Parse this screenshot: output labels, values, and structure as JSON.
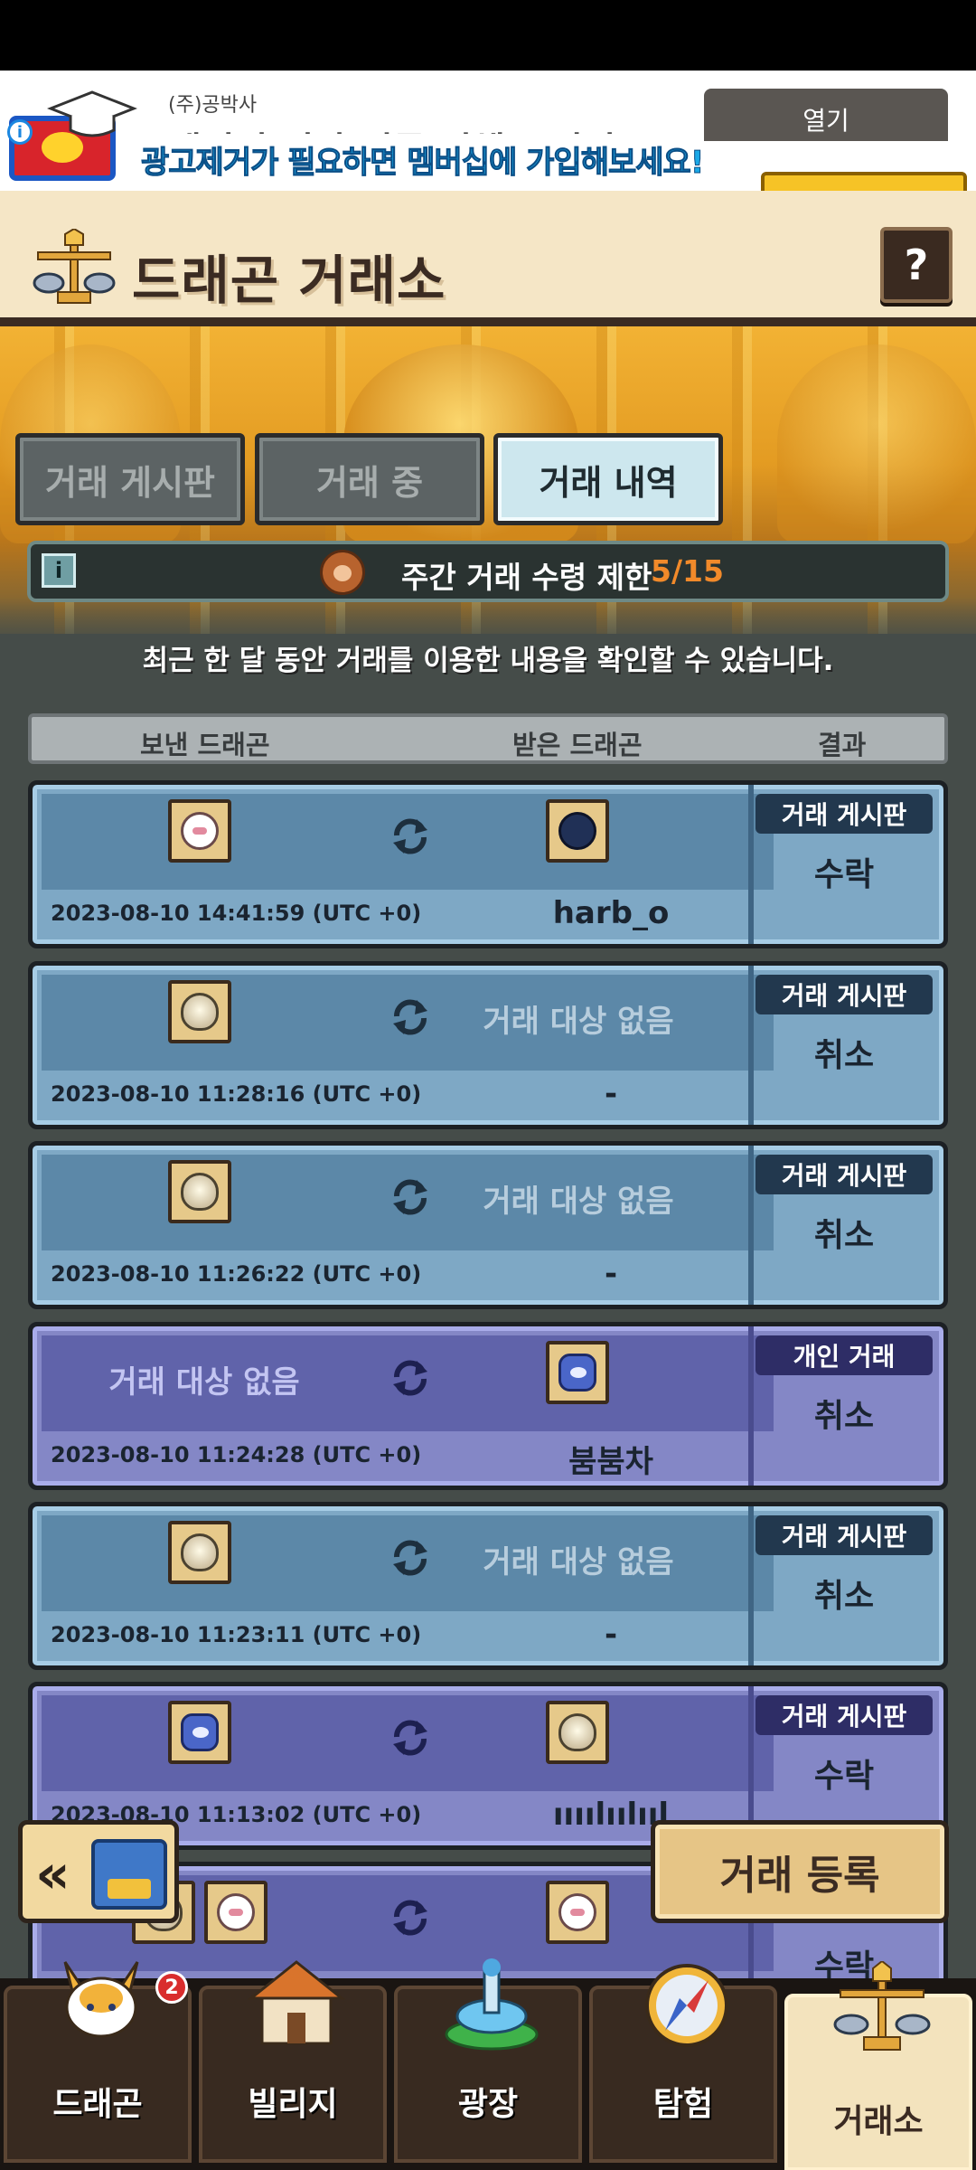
{
  "ad": {
    "sponsor": "(주)공박사",
    "headline": "게이지 정답 전문 업체 공박사",
    "promo": "광고제거가 필요하면 멤버십에 가입해보세요!",
    "open_label": "열기",
    "info_icon": "info-icon"
  },
  "header": {
    "title": "드래곤 거래소",
    "help_label": "?"
  },
  "tabs": [
    {
      "label": "거래 게시판",
      "active": false
    },
    {
      "label": "거래 중",
      "active": false
    },
    {
      "label": "거래 내역",
      "active": true
    }
  ],
  "limit": {
    "label": "주간 거래 수령 제한",
    "value": "5/15"
  },
  "notice": "최근 한 달 동안 거래를 이용한 내용을 확인할 수 있습니다.",
  "table": {
    "headers": [
      "보낸 드래곤",
      "받은 드래곤",
      "결과"
    ]
  },
  "rows": [
    {
      "sent": "cat",
      "received": "bomb",
      "received_name": "harb_o",
      "date": "2023-08-10 14:41:59 (UTC +0)",
      "source": "거래 게시판",
      "result": "수락"
    },
    {
      "sent": "egg",
      "received_none": "거래 대상 없음",
      "received_name": "-",
      "date": "2023-08-10 11:28:16 (UTC +0)",
      "source": "거래 게시판",
      "result": "취소"
    },
    {
      "sent": "egg",
      "received_none": "거래 대상 없음",
      "received_name": "-",
      "date": "2023-08-10 11:26:22 (UTC +0)",
      "source": "거래 게시판",
      "result": "취소"
    },
    {
      "sent_none": "거래 대상 없음",
      "received": "blue-drag",
      "received_name": "붐붐차",
      "date": "2023-08-10 11:24:28 (UTC +0)",
      "source": "개인 거래",
      "result": "취소"
    },
    {
      "sent": "egg",
      "received_none": "거래 대상 없음",
      "received_name": "-",
      "date": "2023-08-10 11:23:11 (UTC +0)",
      "source": "거래 게시판",
      "result": "취소"
    },
    {
      "sent": "blue-drag",
      "received": "egg",
      "received_name": "ıııılıılııl",
      "date": "2023-08-10 11:13:02 (UTC +0)",
      "source": "거래 게시판",
      "result": "수락"
    },
    {
      "result": "수락"
    }
  ],
  "buttons": {
    "back_label": "«",
    "register_label": "거래 등록"
  },
  "nav": {
    "items": [
      {
        "label": "드래곤",
        "badge": "2"
      },
      {
        "label": "빌리지"
      },
      {
        "label": "광장"
      },
      {
        "label": "탐험"
      },
      {
        "label": "거래소",
        "active": true
      }
    ]
  }
}
